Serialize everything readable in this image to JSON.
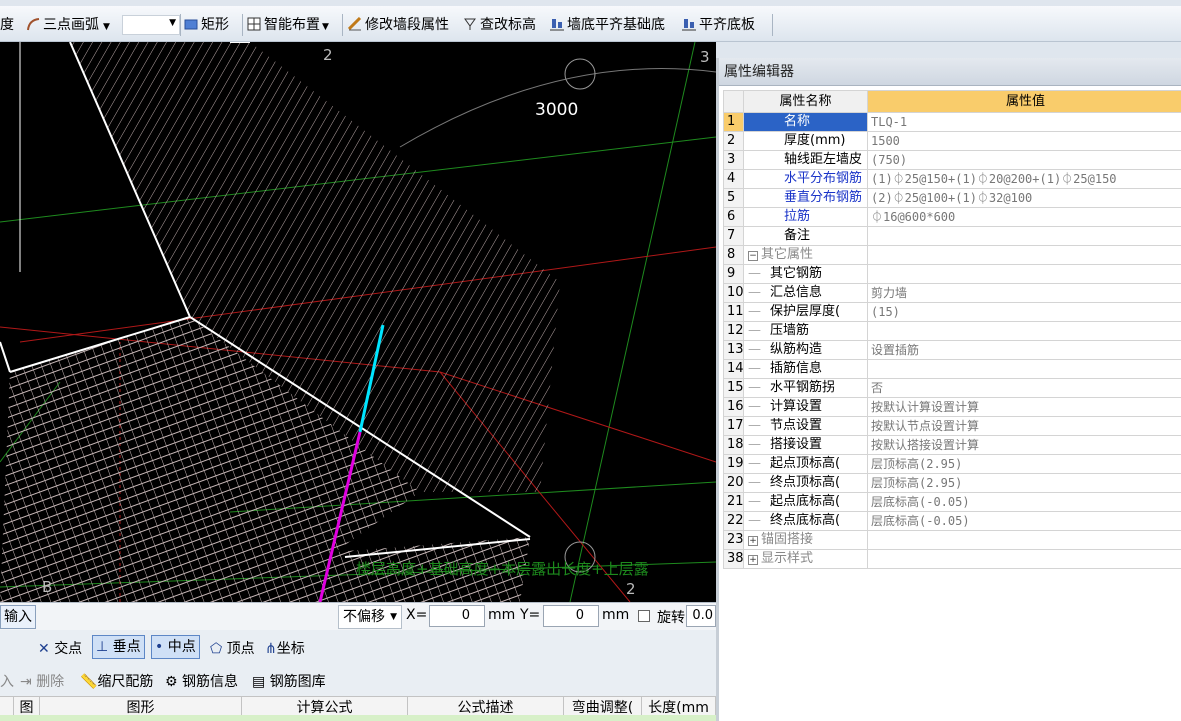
{
  "toolbar": {
    "items": [
      {
        "label": "度",
        "icon": "none"
      },
      {
        "label": "三点画弧",
        "icon": "arc-icon"
      },
      {
        "label": "矩形",
        "icon": "rectangle-icon"
      },
      {
        "label": "智能布置",
        "icon": "smart-layout-icon"
      },
      {
        "label": "修改墙段属性",
        "icon": "edit-wall-icon"
      },
      {
        "label": "查改标高",
        "icon": "elevation-icon"
      },
      {
        "label": "墙底平齐基础底",
        "icon": "align-bottom-icon"
      },
      {
        "label": "平齐底板",
        "icon": "align-slab-icon"
      }
    ]
  },
  "viewport": {
    "dimension_label": "3000",
    "axis_labels": [
      "2",
      "3",
      "B",
      "2"
    ],
    "overlay_text": "楼层高度+基础高度+本层露出长度+上层露",
    "colors": {
      "background": "#000000",
      "mesh": "#c8b8b8",
      "grid_green": "#1e8a1e",
      "grid_red": "#b01818",
      "cyan": "#00e5ff",
      "magenta": "#e000e0"
    }
  },
  "property_editor": {
    "title": "属性编辑器",
    "col_name": "属性名称",
    "col_value": "属性值",
    "rows": [
      {
        "num": "1",
        "name": "名称",
        "value": "TLQ-1",
        "style": "blue",
        "selected": true,
        "indent": 0
      },
      {
        "num": "2",
        "name": "厚度(mm)",
        "value": "1500",
        "style": "normal",
        "indent": 0
      },
      {
        "num": "3",
        "name": "轴线距左墙皮",
        "value": "(750)",
        "style": "normal",
        "indent": 0
      },
      {
        "num": "4",
        "name": "水平分布钢筋",
        "value": "(1)⏀25@150+(1)⏀20@200+(1)⏀25@150",
        "style": "blue",
        "indent": 0
      },
      {
        "num": "5",
        "name": "垂直分布钢筋",
        "value": "(2)⏀25@100+(1)⏀32@100",
        "style": "blue",
        "indent": 0
      },
      {
        "num": "6",
        "name": "拉筋",
        "value": "⏀16@600*600",
        "style": "blue",
        "indent": 0
      },
      {
        "num": "7",
        "name": "备注",
        "value": "",
        "style": "normal",
        "indent": 0
      },
      {
        "num": "8",
        "name": "其它属性",
        "value": "",
        "style": "gray",
        "indent": 0,
        "expander": "−"
      },
      {
        "num": "9",
        "name": "其它钢筋",
        "value": "",
        "style": "normal",
        "indent": 1
      },
      {
        "num": "10",
        "name": "汇总信息",
        "value": "剪力墙",
        "style": "normal",
        "indent": 1
      },
      {
        "num": "11",
        "name": "保护层厚度(",
        "value": "(15)",
        "style": "normal",
        "indent": 1
      },
      {
        "num": "12",
        "name": "压墙筋",
        "value": "",
        "style": "normal",
        "indent": 1
      },
      {
        "num": "13",
        "name": "纵筋构造",
        "value": "设置插筋",
        "style": "normal",
        "indent": 1
      },
      {
        "num": "14",
        "name": "插筋信息",
        "value": "",
        "style": "normal",
        "indent": 1
      },
      {
        "num": "15",
        "name": "水平钢筋拐",
        "value": "否",
        "style": "normal",
        "indent": 1
      },
      {
        "num": "16",
        "name": "计算设置",
        "value": "按默认计算设置计算",
        "style": "normal",
        "indent": 1
      },
      {
        "num": "17",
        "name": "节点设置",
        "value": "按默认节点设置计算",
        "style": "normal",
        "indent": 1
      },
      {
        "num": "18",
        "name": "搭接设置",
        "value": "按默认搭接设置计算",
        "style": "normal",
        "indent": 1
      },
      {
        "num": "19",
        "name": "起点顶标高(",
        "value": "层顶标高(2.95)",
        "style": "normal",
        "indent": 1
      },
      {
        "num": "20",
        "name": "终点顶标高(",
        "value": "层顶标高(2.95)",
        "style": "normal",
        "indent": 1
      },
      {
        "num": "21",
        "name": "起点底标高(",
        "value": "层底标高(-0.05)",
        "style": "normal",
        "indent": 1
      },
      {
        "num": "22",
        "name": "终点底标高(",
        "value": "层底标高(-0.05)",
        "style": "normal",
        "indent": 1
      },
      {
        "num": "23",
        "name": "锚固搭接",
        "value": "",
        "style": "gray",
        "indent": 0,
        "expander": "+"
      },
      {
        "num": "38",
        "name": "显示样式",
        "value": "",
        "style": "gray",
        "indent": 0,
        "expander": "+"
      }
    ]
  },
  "bottom": {
    "input_label": "输入",
    "offset_select": "不偏移",
    "x_label": "X=",
    "x_value": "0",
    "mm1": "mm",
    "y_label": "Y=",
    "y_value": "0",
    "mm2": "mm",
    "rotate_label": "旋转",
    "rotate_value": "0.0",
    "snap": {
      "intersection": "交点",
      "perpendicular": "垂点",
      "midpoint": "中点",
      "vertex": "顶点",
      "coordinate": "坐标"
    },
    "actions": {
      "insert": "入",
      "delete": "删除",
      "scale_rebar": "缩尺配筋",
      "rebar_info": "钢筋信息",
      "rebar_library": "钢筋图库"
    },
    "table_headers": [
      "图",
      "图形",
      "计算公式",
      "公式描述",
      "弯曲调整(",
      "长度(mm"
    ]
  }
}
